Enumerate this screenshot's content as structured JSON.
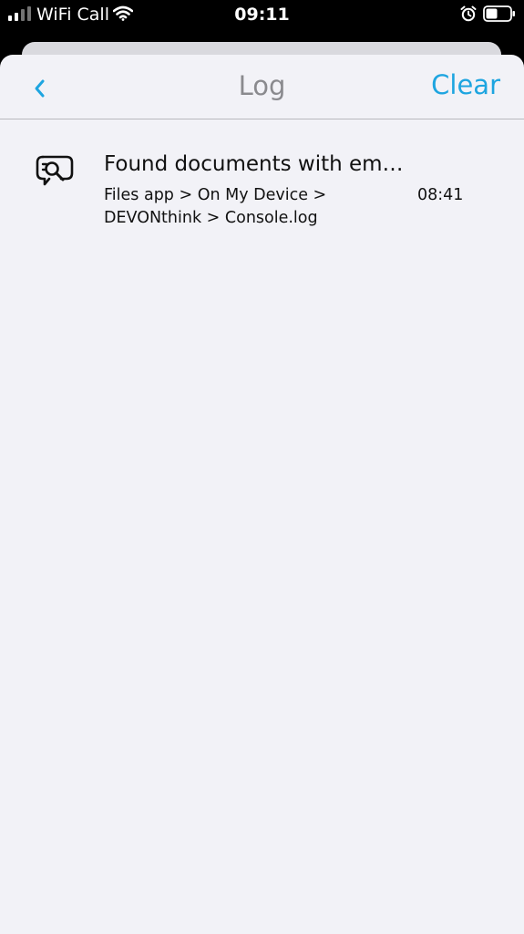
{
  "status_bar": {
    "carrier": "WiFi Call",
    "time": "09:11",
    "icons": [
      "signal-icon",
      "wifi-icon",
      "alarm-icon",
      "battery-icon"
    ]
  },
  "nav": {
    "title": "Log",
    "clear_label": "Clear",
    "back_icon": "chevron-left-icon"
  },
  "log": {
    "entries": [
      {
        "icon": "search-comment-icon",
        "title": "Found documents with em…",
        "path_line1": "Files app > On My Device >",
        "path_line2": "DEVONthink > Console.log",
        "time": "08:41"
      }
    ]
  },
  "colors": {
    "accent": "#1ea5e0",
    "background": "#f2f2f7",
    "title_gray": "#8a8a8e"
  }
}
